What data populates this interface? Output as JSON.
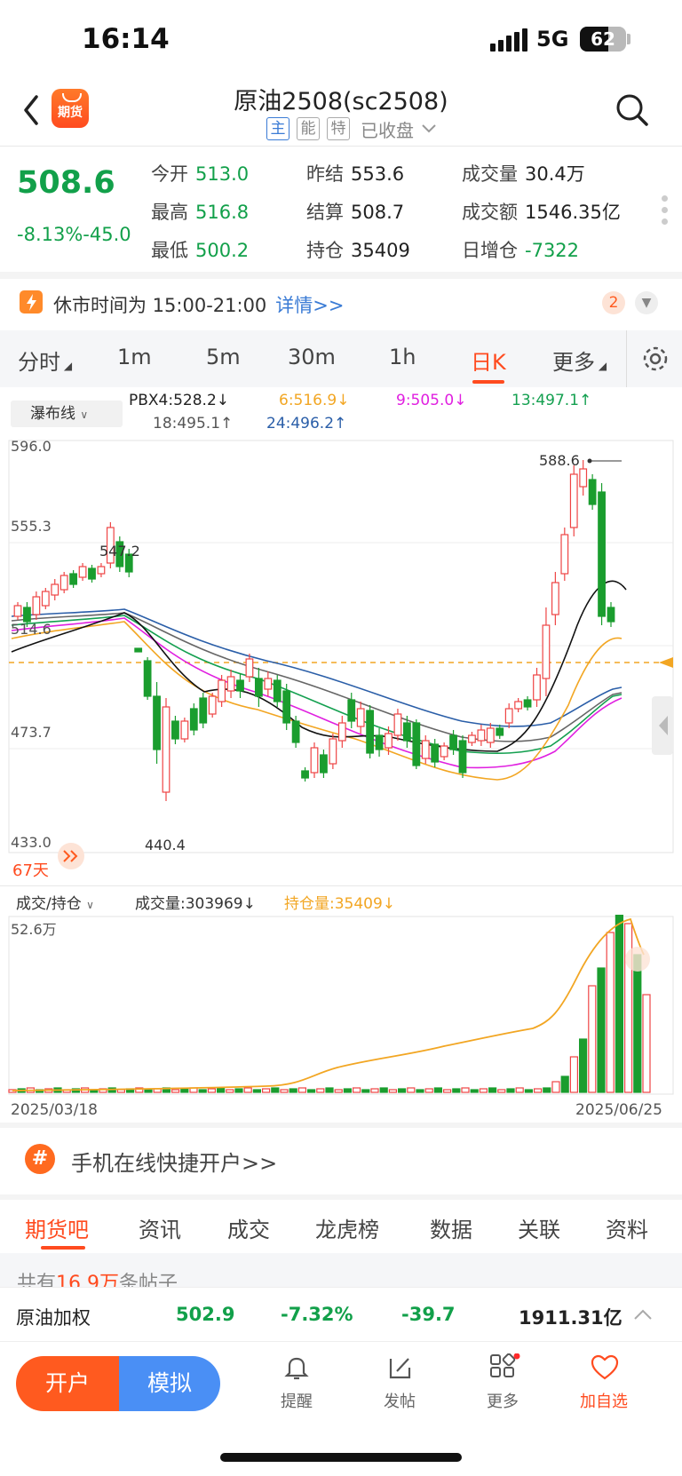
{
  "status_bar": {
    "time": "16:14",
    "network": "5G",
    "battery": "62"
  },
  "header": {
    "title": "原油2508(sc2508)",
    "tags": [
      "主",
      "能",
      "特"
    ],
    "market_state": "已收盘"
  },
  "quote": {
    "price": "508.6",
    "change_pct": "-8.13%",
    "change": "-45.0",
    "open_label": "今开",
    "open": "513.0",
    "high_label": "最高",
    "high": "516.8",
    "low_label": "最低",
    "low": "500.2",
    "prev_settle_label": "昨结",
    "prev_settle": "553.6",
    "settle_label": "结算",
    "settle": "508.7",
    "oi_label": "持仓",
    "oi": "35409",
    "vol_label": "成交量",
    "vol": "30.4万",
    "amount_label": "成交额",
    "amount": "1546.35亿",
    "oi_change_label": "日增仓",
    "oi_change": "-7322"
  },
  "notice": {
    "text": "休市时间为 15:00-21:00",
    "link": "详情>>",
    "count": "2"
  },
  "period_tabs": [
    "分时",
    "1m",
    "5m",
    "30m",
    "1h",
    "日K",
    "更多"
  ],
  "indicator": {
    "selector": "瀑布线",
    "items": [
      {
        "text": "PBX4:528.2↓",
        "color": "#222"
      },
      {
        "text": "6:516.9↓",
        "color": "#f2a623"
      },
      {
        "text": "9:505.0↓",
        "color": "#e020e0"
      },
      {
        "text": "13:497.1↑",
        "color": "#14a050"
      },
      {
        "text": "18:495.1↑",
        "color": "#555"
      },
      {
        "text": "24:496.2↑",
        "color": "#2a5ea8"
      }
    ]
  },
  "chart_data": [
    {
      "type": "candlestick",
      "y_ticks": [
        "596.0",
        "555.3",
        "514.6",
        "473.7",
        "433.0"
      ],
      "ylim": [
        433.0,
        596.0
      ],
      "annotations": {
        "high": "588.6",
        "left_high": "547.2",
        "low": "440.4",
        "days": "67天"
      },
      "last_close": 508.6
    },
    {
      "type": "bar",
      "selector": "成交/持仓",
      "legend": [
        "成交量:303969↓",
        "持仓量:35409↓"
      ],
      "y_max_label": "52.6万",
      "x_labels": [
        "2025/03/18",
        "2025/06/25"
      ]
    }
  ],
  "promo": {
    "text": "手机在线快捷开户>>"
  },
  "section_tabs": [
    "期货吧",
    "资讯",
    "成交",
    "龙虎榜",
    "数据",
    "关联",
    "资料"
  ],
  "posts": {
    "prefix": "共有",
    "count": "16.9万",
    "suffix": "条帖子"
  },
  "ticker": {
    "name": "原油加权",
    "price": "502.9",
    "pct": "-7.32%",
    "change": "-39.7",
    "amount": "1911.31亿"
  },
  "actions": {
    "open": "开户",
    "sim": "模拟"
  },
  "nav": [
    "提醒",
    "发帖",
    "更多",
    "加自选"
  ]
}
